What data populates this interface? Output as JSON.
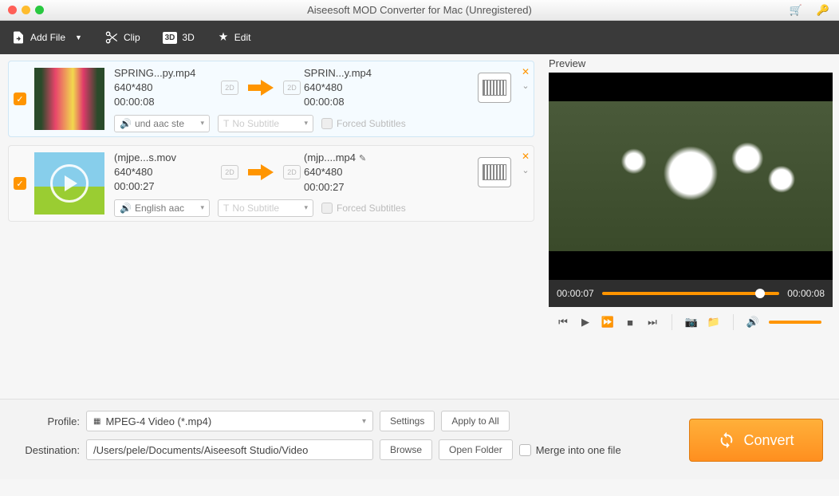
{
  "window": {
    "title": "Aiseesoft MOD Converter for Mac (Unregistered)"
  },
  "toolbar": {
    "addFile": "Add File",
    "clip": "Clip",
    "threeD": "3D",
    "edit": "Edit"
  },
  "items": [
    {
      "checked": true,
      "src": {
        "name": "SPRING...py.mp4",
        "res": "640*480",
        "dur": "00:00:08"
      },
      "dst": {
        "name": "SPRIN...y.mp4",
        "res": "640*480",
        "dur": "00:00:08"
      },
      "audio": "und aac ste",
      "subtitle": "No Subtitle",
      "forced": "Forced Subtitles"
    },
    {
      "checked": true,
      "src": {
        "name": "(mjpe...s.mov",
        "res": "640*480",
        "dur": "00:00:27"
      },
      "dst": {
        "name": "(mjp....mp4",
        "res": "640*480",
        "dur": "00:00:27"
      },
      "audio": "English aac",
      "subtitle": "No Subtitle",
      "forced": "Forced Subtitles"
    }
  ],
  "preview": {
    "label": "Preview",
    "cur": "00:00:07",
    "total": "00:00:08"
  },
  "bottom": {
    "profileLabel": "Profile:",
    "profileValue": "MPEG-4 Video (*.mp4)",
    "settings": "Settings",
    "applyAll": "Apply to All",
    "destLabel": "Destination:",
    "destValue": "/Users/pele/Documents/Aiseesoft Studio/Video",
    "browse": "Browse",
    "openFolder": "Open Folder",
    "merge": "Merge into one file",
    "convert": "Convert"
  }
}
